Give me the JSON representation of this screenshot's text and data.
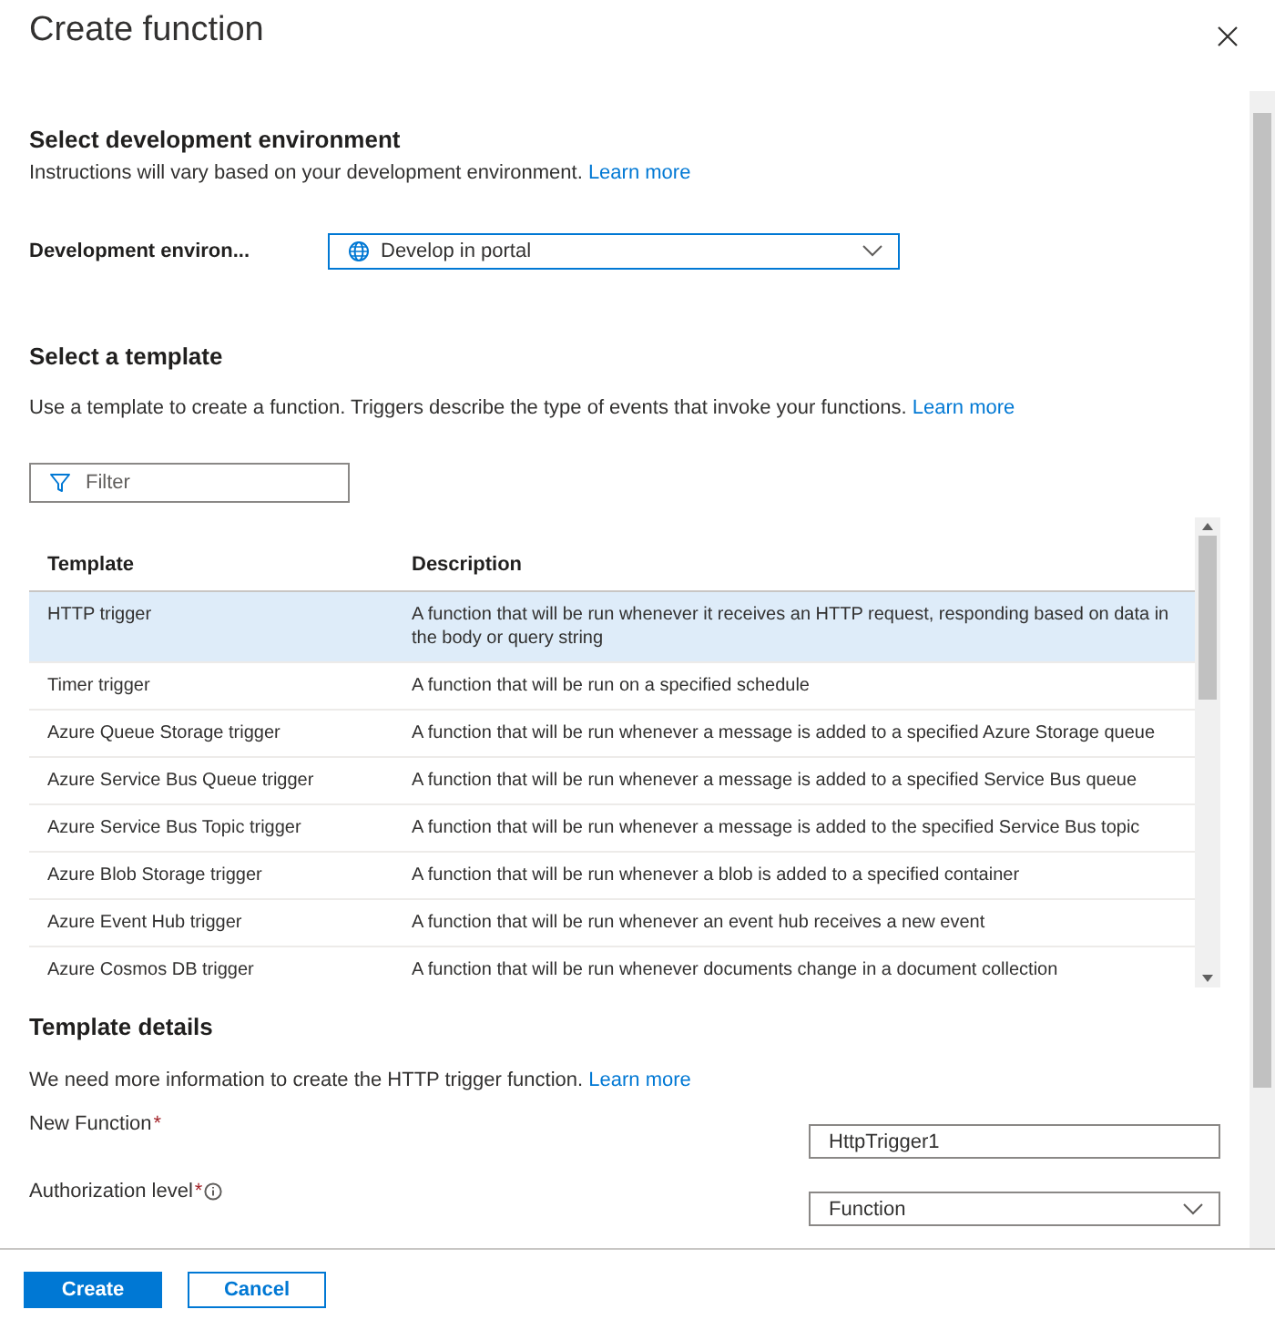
{
  "window": {
    "title": "Create function"
  },
  "environment": {
    "heading": "Select development environment",
    "description": "Instructions will vary based on your development environment.",
    "link": "Learn more",
    "label": "Development environ...",
    "value": "Develop in portal"
  },
  "template_section": {
    "heading": "Select a template",
    "description": "Use a template to create a function. Triggers describe the type of events that invoke your functions.",
    "link": "Learn more",
    "filter": {
      "placeholder": "Filter"
    }
  },
  "table": {
    "columns": [
      "Template",
      "Description"
    ],
    "rows": [
      {
        "template": "HTTP trigger",
        "description": "A function that will be run whenever it receives an HTTP request, responding based on data in the body or query string",
        "selected": true
      },
      {
        "template": "Timer trigger",
        "description": "A function that will be run on a specified schedule",
        "selected": false
      },
      {
        "template": "Azure Queue Storage trigger",
        "description": "A function that will be run whenever a message is added to a specified Azure Storage queue",
        "selected": false
      },
      {
        "template": "Azure Service Bus Queue trigger",
        "description": "A function that will be run whenever a message is added to a specified Service Bus queue",
        "selected": false
      },
      {
        "template": "Azure Service Bus Topic trigger",
        "description": "A function that will be run whenever a message is added to the specified Service Bus topic",
        "selected": false
      },
      {
        "template": "Azure Blob Storage trigger",
        "description": "A function that will be run whenever a blob is added to a specified container",
        "selected": false
      },
      {
        "template": "Azure Event Hub trigger",
        "description": "A function that will be run whenever an event hub receives a new event",
        "selected": false
      },
      {
        "template": "Azure Cosmos DB trigger",
        "description": "A function that will be run whenever documents change in a document collection",
        "selected": false
      }
    ]
  },
  "details": {
    "heading": "Template details",
    "description": "We need more information to create the HTTP trigger function.",
    "link": "Learn more",
    "fields": [
      {
        "kind": "text",
        "label": "New Function",
        "required_marker": "*",
        "value": "HttpTrigger1"
      },
      {
        "kind": "select",
        "label": "Authorization level",
        "required_marker": "*",
        "info": true,
        "value": "Function"
      }
    ]
  },
  "buttons": [
    {
      "label": "Create",
      "primary": true
    },
    {
      "label": "Cancel",
      "primary": false
    }
  ]
}
